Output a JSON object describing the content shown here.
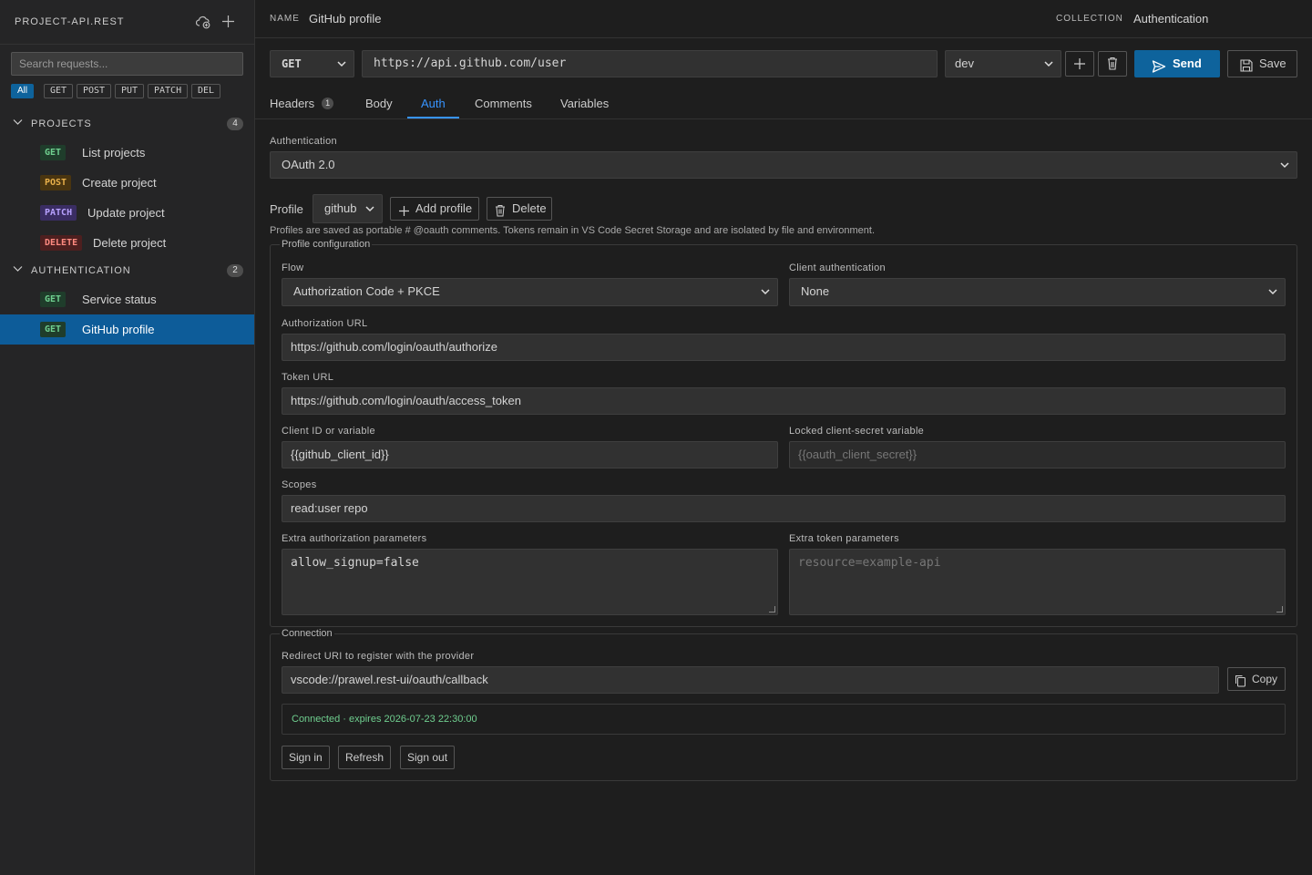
{
  "sidebar": {
    "title": "PROJECT-API.REST",
    "search_placeholder": "Search requests...",
    "filters": [
      "All",
      "GET",
      "POST",
      "PUT",
      "PATCH",
      "DEL"
    ],
    "groups": [
      {
        "name": "PROJECTS",
        "count": "4",
        "items": [
          {
            "method": "GET",
            "label": "List projects"
          },
          {
            "method": "POST",
            "label": "Create project"
          },
          {
            "method": "PATCH",
            "label": "Update project"
          },
          {
            "method": "DELETE",
            "label": "Delete project"
          }
        ]
      },
      {
        "name": "AUTHENTICATION",
        "count": "2",
        "items": [
          {
            "method": "GET",
            "label": "Service status"
          },
          {
            "method": "GET",
            "label": "GitHub profile",
            "selected": true
          }
        ]
      }
    ]
  },
  "header": {
    "name_label": "NAME",
    "name_value": "GitHub profile",
    "collection_label": "COLLECTION",
    "collection_value": "Authentication"
  },
  "request": {
    "method": "GET",
    "url": "https://api.github.com/user",
    "environment": "dev",
    "send_label": "Send",
    "save_label": "Save"
  },
  "tabs": [
    {
      "label": "Headers",
      "count": "1"
    },
    {
      "label": "Body"
    },
    {
      "label": "Auth",
      "active": true
    },
    {
      "label": "Comments"
    },
    {
      "label": "Variables"
    }
  ],
  "auth": {
    "authentication_label": "Authentication",
    "authentication_value": "OAuth 2.0",
    "profile_label": "Profile",
    "profile_value": "github",
    "add_profile_label": "Add profile",
    "delete_label": "Delete",
    "profile_note": "Profiles are saved as portable # @oauth comments. Tokens remain in VS Code Secret Storage and are isolated by file and environment.",
    "profile_config": {
      "legend": "Profile configuration",
      "flow_label": "Flow",
      "flow_value": "Authorization Code + PKCE",
      "client_auth_label": "Client authentication",
      "client_auth_value": "None",
      "auth_url_label": "Authorization URL",
      "auth_url_value": "https://github.com/login/oauth/authorize",
      "token_url_label": "Token URL",
      "token_url_value": "https://github.com/login/oauth/access_token",
      "client_id_label": "Client ID or variable",
      "client_id_value": "{{github_client_id}}",
      "secret_label": "Locked client-secret variable",
      "secret_placeholder": "{{oauth_client_secret}}",
      "scopes_label": "Scopes",
      "scopes_value": "read:user repo",
      "extra_auth_label": "Extra authorization parameters",
      "extra_auth_value": "allow_signup=false",
      "extra_token_label": "Extra token parameters",
      "extra_token_placeholder": "resource=example-api"
    },
    "connection": {
      "legend": "Connection",
      "redirect_label": "Redirect URI to register with the provider",
      "redirect_value": "vscode://prawel.rest-ui/oauth/callback",
      "copy_label": "Copy",
      "status": "Connected · expires 2026-07-23 22:30:00",
      "sign_in_label": "Sign in",
      "refresh_label": "Refresh",
      "sign_out_label": "Sign out"
    }
  },
  "colors": {
    "accent": "#3794ff",
    "send_button": "#0e639c",
    "selected_item": "#0d5c99",
    "connected_status": "#6fcf8f"
  }
}
